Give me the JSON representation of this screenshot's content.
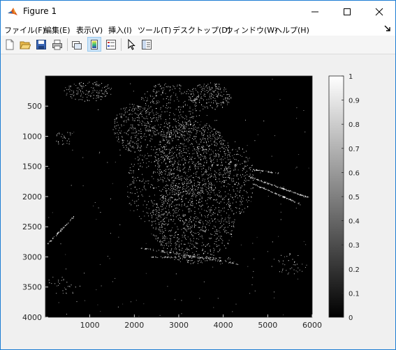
{
  "window": {
    "title": "Figure 1"
  },
  "menu": [
    "ファイル(F)",
    "編集(E)",
    "表示(V)",
    "挿入(I)",
    "ツール(T)",
    "デスクトップ(D)",
    "ウィンドウ(W)",
    "ヘルプ(H)"
  ],
  "toolbar": {
    "buttons": [
      {
        "icon": "new-figure-icon"
      },
      {
        "icon": "open-file-icon"
      },
      {
        "icon": "save-icon"
      },
      {
        "icon": "print-icon"
      },
      {
        "icon": "link-plot-icon"
      },
      {
        "icon": "colorbar-icon",
        "pressed": true
      },
      {
        "icon": "legend-icon"
      },
      {
        "icon": "edit-plot-pointer-icon"
      },
      {
        "icon": "property-inspector-icon"
      }
    ]
  },
  "plot": {
    "image_description_shown": "binary edge map (black background, white edge pixels)",
    "x_ticks": [
      "1000",
      "2000",
      "3000",
      "4000",
      "5000",
      "6000"
    ],
    "y_ticks": [
      "500",
      "1000",
      "1500",
      "2000",
      "2500",
      "3000",
      "3500",
      "4000"
    ],
    "x_range": [
      1,
      6000
    ],
    "y_range": [
      1,
      4000
    ],
    "colorbar_ticks": [
      "0",
      "0.1",
      "0.2",
      "0.3",
      "0.4",
      "0.5",
      "0.6",
      "0.7",
      "0.8",
      "0.9",
      "1"
    ],
    "colorbar_range": [
      0,
      1
    ],
    "colormap": "gray",
    "colors": {
      "background": "#000000",
      "edge": "#ffffff"
    }
  }
}
